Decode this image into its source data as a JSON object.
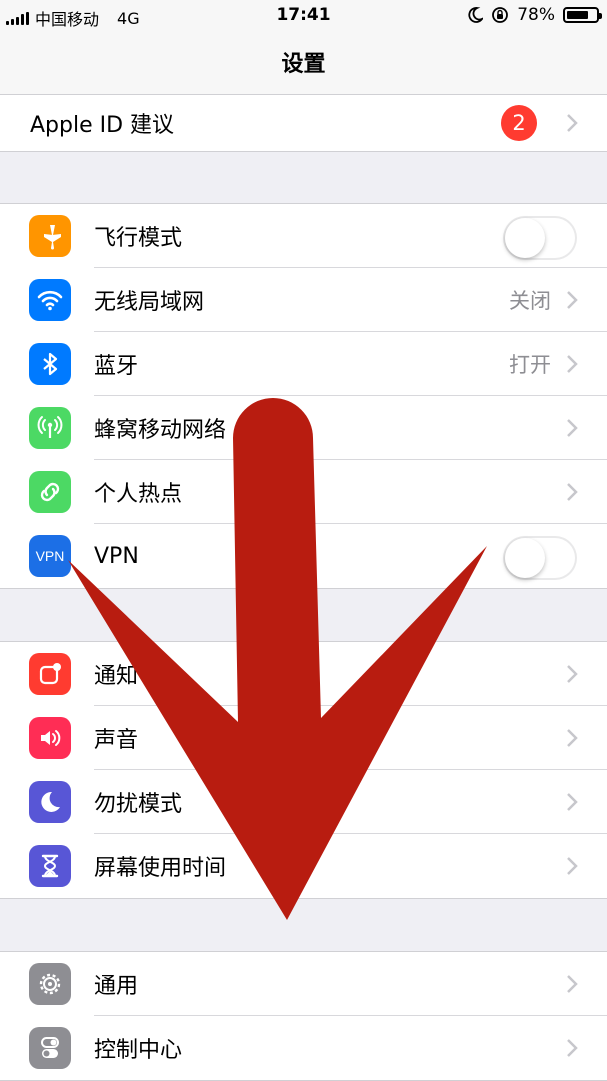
{
  "status": {
    "carrier": "中国移动",
    "network": "4G",
    "time": "17:41",
    "battery": "78%",
    "battery_level": 0.78
  },
  "nav": {
    "title": "设置"
  },
  "account": {
    "label": "Apple ID 建议",
    "badge": "2"
  },
  "network_group": [
    {
      "label": "飞行模式",
      "icon": "airplane-icon",
      "color": "#ff9500",
      "toggle": false
    },
    {
      "label": "无线局域网",
      "icon": "wifi-icon",
      "color": "#007aff",
      "value": "关闭"
    },
    {
      "label": "蓝牙",
      "icon": "bluetooth-icon",
      "color": "#007aff",
      "value": "打开"
    },
    {
      "label": "蜂窝移动网络",
      "icon": "cellular-icon",
      "color": "#4cd964"
    },
    {
      "label": "个人热点",
      "icon": "hotspot-icon",
      "color": "#4cd964"
    },
    {
      "label": "VPN",
      "icon": "vpn-icon",
      "icon_text": "VPN",
      "color": "#1c6fe6",
      "toggle": false
    }
  ],
  "notify_group": [
    {
      "label": "通知",
      "icon": "notifications-icon",
      "color": "#ff3b30"
    },
    {
      "label": "声音",
      "icon": "sound-icon",
      "color": "#ff2d55"
    },
    {
      "label": "勿扰模式",
      "icon": "moon-icon",
      "color": "#5856d6"
    },
    {
      "label": "屏幕使用时间",
      "icon": "hourglass-icon",
      "color": "#5856d6"
    }
  ],
  "general_group": [
    {
      "label": "通用",
      "icon": "gear-icon",
      "color": "#8e8e93"
    },
    {
      "label": "控制中心",
      "icon": "switches-icon",
      "color": "#8e8e93"
    }
  ],
  "overlay": {
    "icon": "red-down-arrow-icon",
    "color": "#b81c10"
  }
}
